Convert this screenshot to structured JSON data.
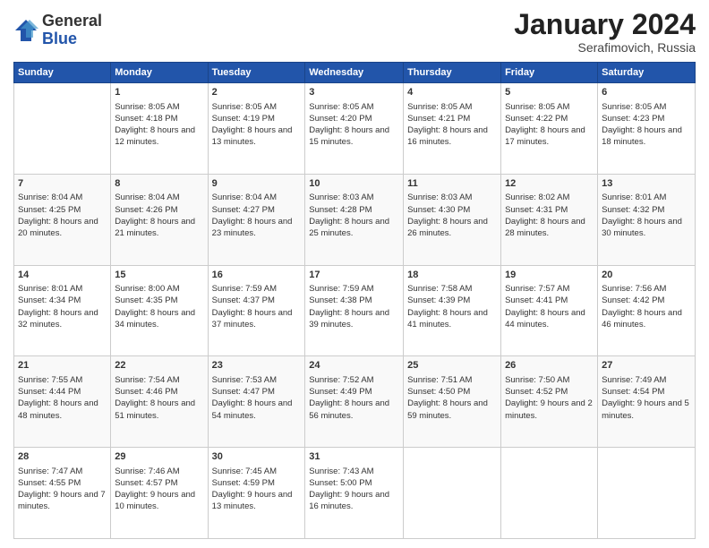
{
  "logo": {
    "general": "General",
    "blue": "Blue"
  },
  "title": "January 2024",
  "location": "Serafimovich, Russia",
  "days_header": [
    "Sunday",
    "Monday",
    "Tuesday",
    "Wednesday",
    "Thursday",
    "Friday",
    "Saturday"
  ],
  "weeks": [
    [
      {
        "day": "",
        "sunrise": "",
        "sunset": "",
        "daylight": ""
      },
      {
        "day": "1",
        "sunrise": "Sunrise: 8:05 AM",
        "sunset": "Sunset: 4:18 PM",
        "daylight": "Daylight: 8 hours and 12 minutes."
      },
      {
        "day": "2",
        "sunrise": "Sunrise: 8:05 AM",
        "sunset": "Sunset: 4:19 PM",
        "daylight": "Daylight: 8 hours and 13 minutes."
      },
      {
        "day": "3",
        "sunrise": "Sunrise: 8:05 AM",
        "sunset": "Sunset: 4:20 PM",
        "daylight": "Daylight: 8 hours and 15 minutes."
      },
      {
        "day": "4",
        "sunrise": "Sunrise: 8:05 AM",
        "sunset": "Sunset: 4:21 PM",
        "daylight": "Daylight: 8 hours and 16 minutes."
      },
      {
        "day": "5",
        "sunrise": "Sunrise: 8:05 AM",
        "sunset": "Sunset: 4:22 PM",
        "daylight": "Daylight: 8 hours and 17 minutes."
      },
      {
        "day": "6",
        "sunrise": "Sunrise: 8:05 AM",
        "sunset": "Sunset: 4:23 PM",
        "daylight": "Daylight: 8 hours and 18 minutes."
      }
    ],
    [
      {
        "day": "7",
        "sunrise": "Sunrise: 8:04 AM",
        "sunset": "Sunset: 4:25 PM",
        "daylight": "Daylight: 8 hours and 20 minutes."
      },
      {
        "day": "8",
        "sunrise": "Sunrise: 8:04 AM",
        "sunset": "Sunset: 4:26 PM",
        "daylight": "Daylight: 8 hours and 21 minutes."
      },
      {
        "day": "9",
        "sunrise": "Sunrise: 8:04 AM",
        "sunset": "Sunset: 4:27 PM",
        "daylight": "Daylight: 8 hours and 23 minutes."
      },
      {
        "day": "10",
        "sunrise": "Sunrise: 8:03 AM",
        "sunset": "Sunset: 4:28 PM",
        "daylight": "Daylight: 8 hours and 25 minutes."
      },
      {
        "day": "11",
        "sunrise": "Sunrise: 8:03 AM",
        "sunset": "Sunset: 4:30 PM",
        "daylight": "Daylight: 8 hours and 26 minutes."
      },
      {
        "day": "12",
        "sunrise": "Sunrise: 8:02 AM",
        "sunset": "Sunset: 4:31 PM",
        "daylight": "Daylight: 8 hours and 28 minutes."
      },
      {
        "day": "13",
        "sunrise": "Sunrise: 8:01 AM",
        "sunset": "Sunset: 4:32 PM",
        "daylight": "Daylight: 8 hours and 30 minutes."
      }
    ],
    [
      {
        "day": "14",
        "sunrise": "Sunrise: 8:01 AM",
        "sunset": "Sunset: 4:34 PM",
        "daylight": "Daylight: 8 hours and 32 minutes."
      },
      {
        "day": "15",
        "sunrise": "Sunrise: 8:00 AM",
        "sunset": "Sunset: 4:35 PM",
        "daylight": "Daylight: 8 hours and 34 minutes."
      },
      {
        "day": "16",
        "sunrise": "Sunrise: 7:59 AM",
        "sunset": "Sunset: 4:37 PM",
        "daylight": "Daylight: 8 hours and 37 minutes."
      },
      {
        "day": "17",
        "sunrise": "Sunrise: 7:59 AM",
        "sunset": "Sunset: 4:38 PM",
        "daylight": "Daylight: 8 hours and 39 minutes."
      },
      {
        "day": "18",
        "sunrise": "Sunrise: 7:58 AM",
        "sunset": "Sunset: 4:39 PM",
        "daylight": "Daylight: 8 hours and 41 minutes."
      },
      {
        "day": "19",
        "sunrise": "Sunrise: 7:57 AM",
        "sunset": "Sunset: 4:41 PM",
        "daylight": "Daylight: 8 hours and 44 minutes."
      },
      {
        "day": "20",
        "sunrise": "Sunrise: 7:56 AM",
        "sunset": "Sunset: 4:42 PM",
        "daylight": "Daylight: 8 hours and 46 minutes."
      }
    ],
    [
      {
        "day": "21",
        "sunrise": "Sunrise: 7:55 AM",
        "sunset": "Sunset: 4:44 PM",
        "daylight": "Daylight: 8 hours and 48 minutes."
      },
      {
        "day": "22",
        "sunrise": "Sunrise: 7:54 AM",
        "sunset": "Sunset: 4:46 PM",
        "daylight": "Daylight: 8 hours and 51 minutes."
      },
      {
        "day": "23",
        "sunrise": "Sunrise: 7:53 AM",
        "sunset": "Sunset: 4:47 PM",
        "daylight": "Daylight: 8 hours and 54 minutes."
      },
      {
        "day": "24",
        "sunrise": "Sunrise: 7:52 AM",
        "sunset": "Sunset: 4:49 PM",
        "daylight": "Daylight: 8 hours and 56 minutes."
      },
      {
        "day": "25",
        "sunrise": "Sunrise: 7:51 AM",
        "sunset": "Sunset: 4:50 PM",
        "daylight": "Daylight: 8 hours and 59 minutes."
      },
      {
        "day": "26",
        "sunrise": "Sunrise: 7:50 AM",
        "sunset": "Sunset: 4:52 PM",
        "daylight": "Daylight: 9 hours and 2 minutes."
      },
      {
        "day": "27",
        "sunrise": "Sunrise: 7:49 AM",
        "sunset": "Sunset: 4:54 PM",
        "daylight": "Daylight: 9 hours and 5 minutes."
      }
    ],
    [
      {
        "day": "28",
        "sunrise": "Sunrise: 7:47 AM",
        "sunset": "Sunset: 4:55 PM",
        "daylight": "Daylight: 9 hours and 7 minutes."
      },
      {
        "day": "29",
        "sunrise": "Sunrise: 7:46 AM",
        "sunset": "Sunset: 4:57 PM",
        "daylight": "Daylight: 9 hours and 10 minutes."
      },
      {
        "day": "30",
        "sunrise": "Sunrise: 7:45 AM",
        "sunset": "Sunset: 4:59 PM",
        "daylight": "Daylight: 9 hours and 13 minutes."
      },
      {
        "day": "31",
        "sunrise": "Sunrise: 7:43 AM",
        "sunset": "Sunset: 5:00 PM",
        "daylight": "Daylight: 9 hours and 16 minutes."
      },
      {
        "day": "",
        "sunrise": "",
        "sunset": "",
        "daylight": ""
      },
      {
        "day": "",
        "sunrise": "",
        "sunset": "",
        "daylight": ""
      },
      {
        "day": "",
        "sunrise": "",
        "sunset": "",
        "daylight": ""
      }
    ]
  ]
}
